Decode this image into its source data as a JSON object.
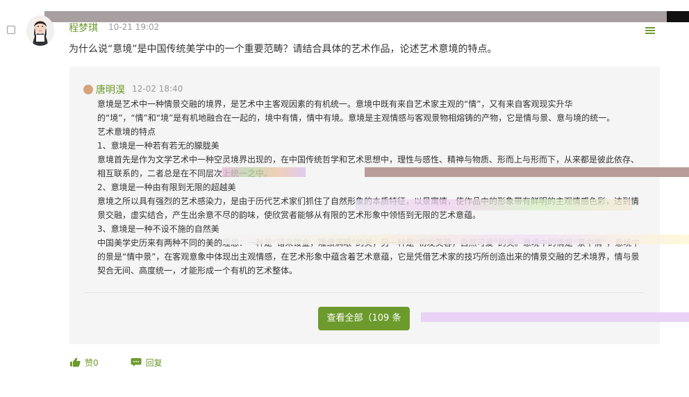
{
  "post": {
    "author": "程梦琪",
    "time": "10-21 19:02",
    "question": "为什么说“意境”是中国传统美学中的一个重要范畴？请结合具体的艺术作品，论述艺术意境的特点。"
  },
  "reply": {
    "author": "唐明淏",
    "time": "12-02 18:40",
    "paragraphs": [
      "意境是艺术中一种情景交融的境界，是艺术中主客观因素的有机统一。意境中既有来自艺术家主观的“情”，又有来自客观现实升华的“境”，“情”和“境”是有机地融合在一起的，境中有情，情中有境。意境是主观情感与客观景物相熔铸的产物，它是情与景、意与境的统一。",
      "艺术意境的特点",
      "1、意境是一种若有若无的朦胧美",
      "意境首先是作为文学艺术中一种空灵境界出现的，在中国传统哲学和艺术思想中，理性与感性、精神与物质、形而上与形而下，从来都是彼此依存、相互联系的，二者总是在不同层次上统一之中。",
      "2、意境是一种由有限到无限的超越美",
      "意境之所以具有强烈的艺术感染力，是由于历代艺术家们抓住了自然形象的本质特征，以景寓情，使作品中的形象带有鲜明的主观情感色彩，达到情景交融，虚实结合，产生出余意不尽的韵味，使欣赏者能够从有限的艺术形象中领悟到无限的艺术意蕴。",
      "3、意境是一种不设不施的自然美",
      "中国美学史历来有两种不同的美的理想：一种是“错采镂金，雕缋满眼”的美，另一种是“初发芙蓉，自然可爱”的美。意境中的情是“景中情”，意境中的景是“情中景”，在客观意象中体现出主观情感，在艺术形象中蕴含着艺术意蕴，它是凭借艺术家的技巧所创造出来的情景交融的艺术境界，情与景契合无间、高度统一，才能形成一个有机的艺术整体。"
    ]
  },
  "view_all_label": "查看全部（109 条",
  "actions": {
    "like_label": "赞0",
    "reply_label": "回复"
  },
  "colors": {
    "accent": "#6c9a2c",
    "panel": "#f5f5f5"
  },
  "icons": [
    "menu-icon",
    "thumbs-up-icon",
    "comment-icon"
  ]
}
